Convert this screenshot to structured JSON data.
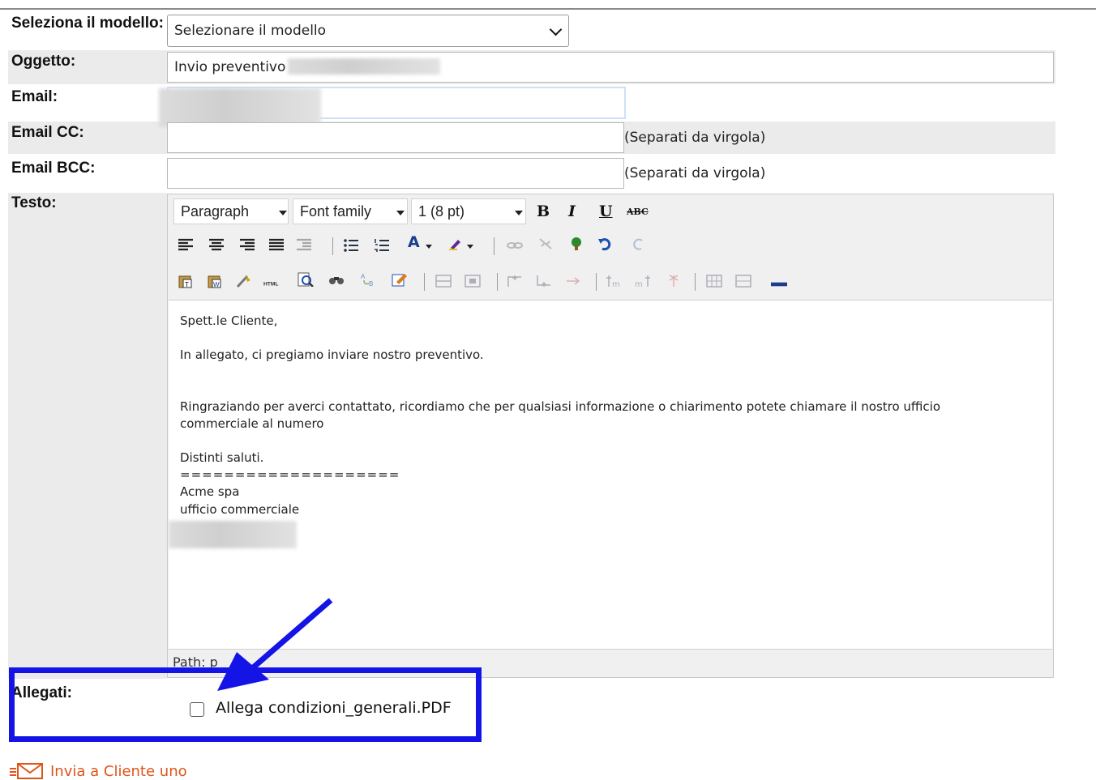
{
  "form": {
    "template_label": "Seleziona il modello:",
    "template_value": "Selezionare il modello",
    "subject_label": "Oggetto:",
    "subject_value": "Invio preventivo N",
    "email_label": "Email:",
    "email_cc_label": "Email CC:",
    "email_bcc_label": "Email BCC:",
    "separator_note": "(Separati da virgola)",
    "text_label": "Testo:"
  },
  "editor": {
    "format_select": "Paragraph",
    "font_family_select": "Font family",
    "font_size_select": "1 (8 pt)",
    "bold": "B",
    "italic": "I",
    "underline": "U",
    "strike": "ABC",
    "path_label": "Path: p",
    "body": {
      "greeting": "Spett.le Cliente,",
      "line1": "In allegato, ci pregiamo inviare nostro preventivo.",
      "line2a": "Ringraziando per averci contattato, ricordiamo che per qualsiasi informazione o chiarimento potete chiamare il nostro ufficio",
      "line2b": "commerciale al numero",
      "closing": "Distinti saluti.",
      "divider": "====================",
      "company": "Acme spa",
      "department": "ufficio commerciale"
    }
  },
  "attachments": {
    "label": "Allegati:",
    "checkbox_label": "Allega condizioni_generali.PDF",
    "checked": false
  },
  "send_link": "Invia a Cliente uno",
  "colors": {
    "highlight_box": "#1414e6",
    "arrow": "#1414e6",
    "send_link": "#e0541a",
    "row_background": "#ebebeb"
  }
}
